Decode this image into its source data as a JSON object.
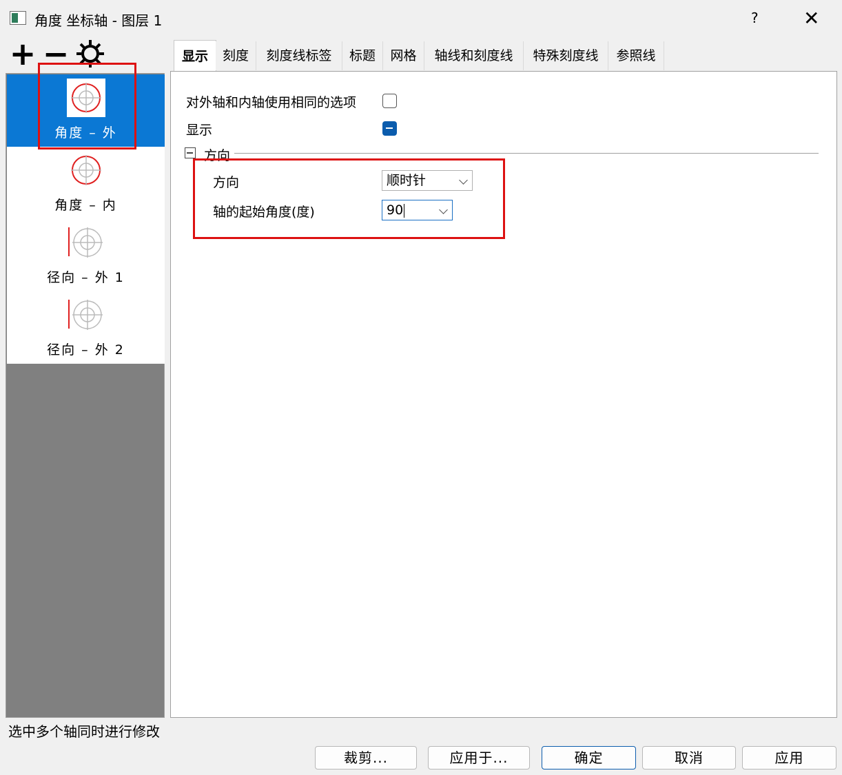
{
  "window": {
    "title": "角度 坐标轴 - 图层 1",
    "help_label": "?",
    "close_label": "✕"
  },
  "toolbar": {
    "add_label": "+",
    "remove_label": "−",
    "settings_icon": "gear-icon"
  },
  "axis_list": [
    {
      "label": "角度 – 外",
      "selected": true
    },
    {
      "label": "角度 – 内",
      "selected": false
    },
    {
      "label": "径向 – 外 1",
      "selected": false
    },
    {
      "label": "径向 – 外 2",
      "selected": false
    }
  ],
  "status_text": "选中多个轴同时进行修改",
  "tabs": [
    {
      "label": "显示",
      "active": true
    },
    {
      "label": "刻度"
    },
    {
      "label": "刻度线标签"
    },
    {
      "label": "标题"
    },
    {
      "label": "网格"
    },
    {
      "label": "轴线和刻度线"
    },
    {
      "label": "特殊刻度线"
    },
    {
      "label": "参照线"
    }
  ],
  "display": {
    "same_options_label": "对外轴和内轴使用相同的选项",
    "same_options_checked": false,
    "show_label": "显示",
    "show_state": "indeterminate",
    "direction_group_label": "方向",
    "direction_label": "方向",
    "direction_value": "顺时针",
    "start_angle_label": "轴的起始角度(度)",
    "start_angle_value": "90"
  },
  "buttons": {
    "crop": "裁剪...",
    "apply_to": "应用于...",
    "ok": "确定",
    "cancel": "取消",
    "apply": "应用"
  },
  "colors": {
    "selection": "#0b78d4",
    "highlight_box": "#dd1111",
    "axis_red": "#e02020"
  }
}
